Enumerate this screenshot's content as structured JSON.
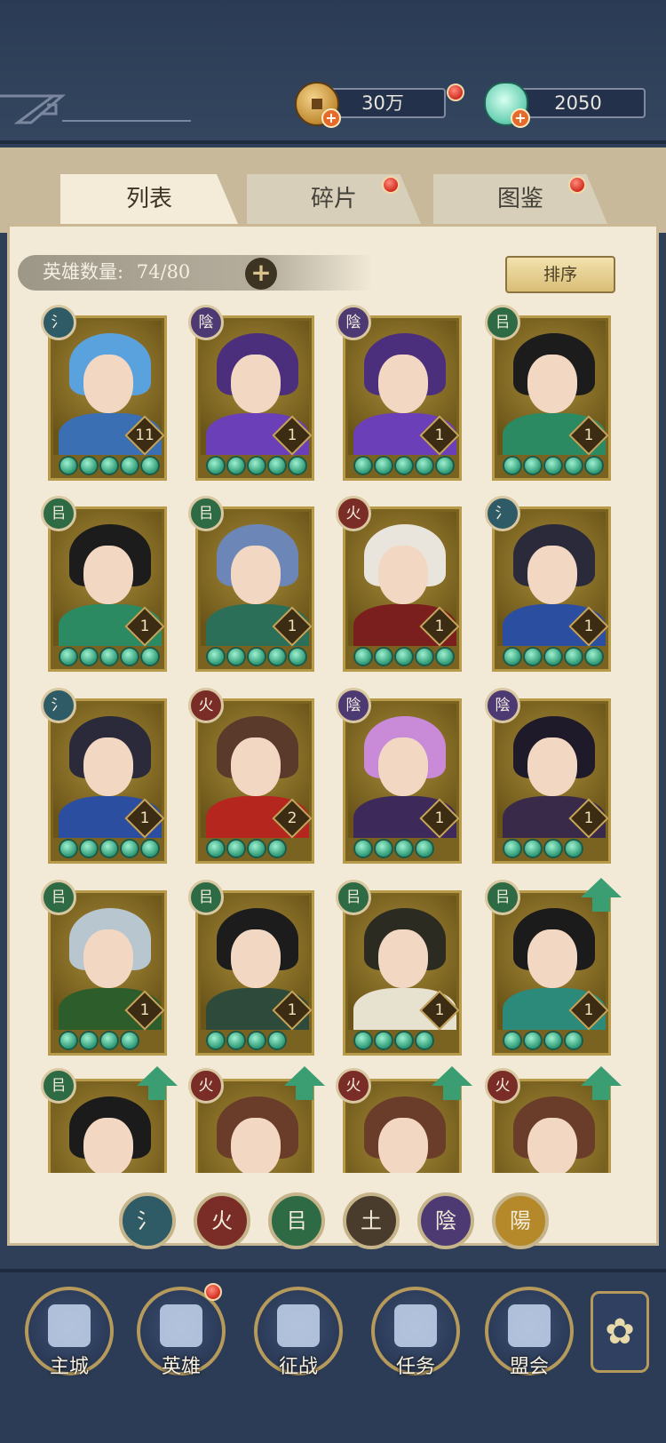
{
  "currencies": {
    "coins": {
      "amount": "30万",
      "icon": "coin-icon"
    },
    "shells": {
      "amount": "2050",
      "icon": "shell-icon"
    }
  },
  "tabs": [
    {
      "label": "列表",
      "active": true
    },
    {
      "label": "碎片",
      "active": false,
      "badge": true
    },
    {
      "label": "图鉴",
      "active": false,
      "badge": true
    }
  ],
  "hero_count": {
    "label": "英雄数量:",
    "value": "74/80"
  },
  "sort_label": "排序",
  "heroes": [
    {
      "element": "氵",
      "element_type": "water",
      "level": "11",
      "stars": 5
    },
    {
      "element": "陰",
      "element_type": "yin",
      "level": "1",
      "stars": 5
    },
    {
      "element": "陰",
      "element_type": "yin",
      "level": "1",
      "stars": 5
    },
    {
      "element": "㠯",
      "element_type": "wood",
      "level": "1",
      "stars": 5
    },
    {
      "element": "㠯",
      "element_type": "wood",
      "level": "1",
      "stars": 5
    },
    {
      "element": "㠯",
      "element_type": "wood",
      "level": "1",
      "stars": 5
    },
    {
      "element": "火",
      "element_type": "fire",
      "level": "1",
      "stars": 5
    },
    {
      "element": "氵",
      "element_type": "water",
      "level": "1",
      "stars": 5
    },
    {
      "element": "氵",
      "element_type": "water",
      "level": "1",
      "stars": 5
    },
    {
      "element": "火",
      "element_type": "fire",
      "level": "2",
      "stars": 4
    },
    {
      "element": "陰",
      "element_type": "yin",
      "level": "1",
      "stars": 4
    },
    {
      "element": "陰",
      "element_type": "yin",
      "level": "1",
      "stars": 4
    },
    {
      "element": "㠯",
      "element_type": "wood",
      "level": "1",
      "stars": 4
    },
    {
      "element": "㠯",
      "element_type": "wood",
      "level": "1",
      "stars": 4
    },
    {
      "element": "㠯",
      "element_type": "wood",
      "level": "1",
      "stars": 4
    },
    {
      "element": "㠯",
      "element_type": "wood",
      "level": "1",
      "stars": 4,
      "upgrade": true
    },
    {
      "element": "㠯",
      "element_type": "wood",
      "upgrade": true
    },
    {
      "element": "火",
      "element_type": "fire",
      "upgrade": true
    },
    {
      "element": "火",
      "element_type": "fire",
      "upgrade": true
    },
    {
      "element": "火",
      "element_type": "fire",
      "upgrade": true
    }
  ],
  "element_filters": [
    {
      "glyph": "氵",
      "color": "#2f5b66"
    },
    {
      "glyph": "火",
      "color": "#7a2d27"
    },
    {
      "glyph": "㠯",
      "color": "#2e6a44"
    },
    {
      "glyph": "土",
      "color": "#4a3c2c"
    },
    {
      "glyph": "陰",
      "color": "#4d3a72"
    },
    {
      "glyph": "陽",
      "color": "#b5892a"
    }
  ],
  "nav": [
    {
      "label": "主城",
      "icon": "castle-icon"
    },
    {
      "label": "英雄",
      "icon": "hero-icon",
      "badge": true
    },
    {
      "label": "征战",
      "icon": "battle-icon"
    },
    {
      "label": "任务",
      "icon": "task-icon"
    },
    {
      "label": "盟会",
      "icon": "guild-icon"
    }
  ],
  "nav_more_icon": "menu-flower-icon"
}
